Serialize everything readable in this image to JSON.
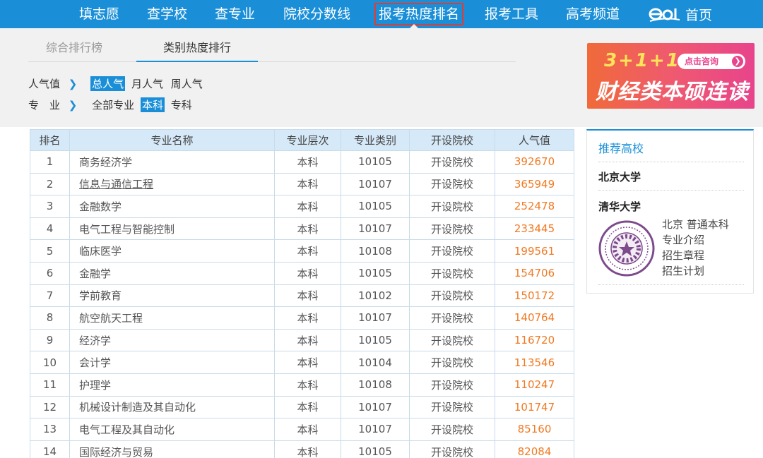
{
  "nav": {
    "items": [
      "填志愿",
      "查学校",
      "查专业",
      "院校分数线",
      "报考热度排名",
      "报考工具",
      "高考频道"
    ],
    "active_index": 4,
    "home_label": "首页",
    "logo_text": "eol"
  },
  "tabs": [
    "综合排行榜",
    "类别热度排行"
  ],
  "active_tab": 1,
  "filters": {
    "popularity": {
      "label": "人气值",
      "options": [
        "总人气",
        "月人气",
        "周人气"
      ],
      "selected": 0
    },
    "major": {
      "label": "专　业",
      "options": [
        "全部专业",
        "本科",
        "专科"
      ],
      "selected": 1
    }
  },
  "ad": {
    "line1": "3+1+1",
    "button": "点击咨询",
    "line2": "财经类本硕连读"
  },
  "table": {
    "headers": [
      "排名",
      "专业名称",
      "专业层次",
      "专业类别",
      "开设院校",
      "人气值"
    ],
    "rows": [
      [
        "1",
        "商务经济学",
        "本科",
        "10105",
        "开设院校",
        "392670"
      ],
      [
        "2",
        "信息与通信工程",
        "本科",
        "10107",
        "开设院校",
        "365949"
      ],
      [
        "3",
        "金融数学",
        "本科",
        "10105",
        "开设院校",
        "252478"
      ],
      [
        "4",
        "电气工程与智能控制",
        "本科",
        "10107",
        "开设院校",
        "233445"
      ],
      [
        "5",
        "临床医学",
        "本科",
        "10108",
        "开设院校",
        "199561"
      ],
      [
        "6",
        "金融学",
        "本科",
        "10105",
        "开设院校",
        "154706"
      ],
      [
        "7",
        "学前教育",
        "本科",
        "10102",
        "开设院校",
        "150172"
      ],
      [
        "8",
        "航空航天工程",
        "本科",
        "10107",
        "开设院校",
        "140764"
      ],
      [
        "9",
        "经济学",
        "本科",
        "10105",
        "开设院校",
        "116720"
      ],
      [
        "10",
        "会计学",
        "本科",
        "10104",
        "开设院校",
        "113546"
      ],
      [
        "11",
        "护理学",
        "本科",
        "10108",
        "开设院校",
        "110247"
      ],
      [
        "12",
        "机械设计制造及其自动化",
        "本科",
        "10107",
        "开设院校",
        "101747"
      ],
      [
        "13",
        "电气工程及其自动化",
        "本科",
        "10107",
        "开设院校",
        "85160"
      ],
      [
        "14",
        "国际经济与贸易",
        "本科",
        "10105",
        "开设院校",
        "82084"
      ]
    ]
  },
  "sidebar": {
    "title": "推荐高校",
    "schools": [
      "北京大学",
      "清华大学"
    ],
    "tsinghua_info": {
      "location_type": "北京 普通本科",
      "links": [
        "专业介绍",
        "招生章程",
        "招生计划"
      ]
    }
  },
  "colors": {
    "nav_bg": "#1a8fd8",
    "accent": "#1a8fd8",
    "popularity_value": "#f07a23",
    "active_nav_border": "#e53b2f",
    "seal": "#7d4a8c"
  }
}
